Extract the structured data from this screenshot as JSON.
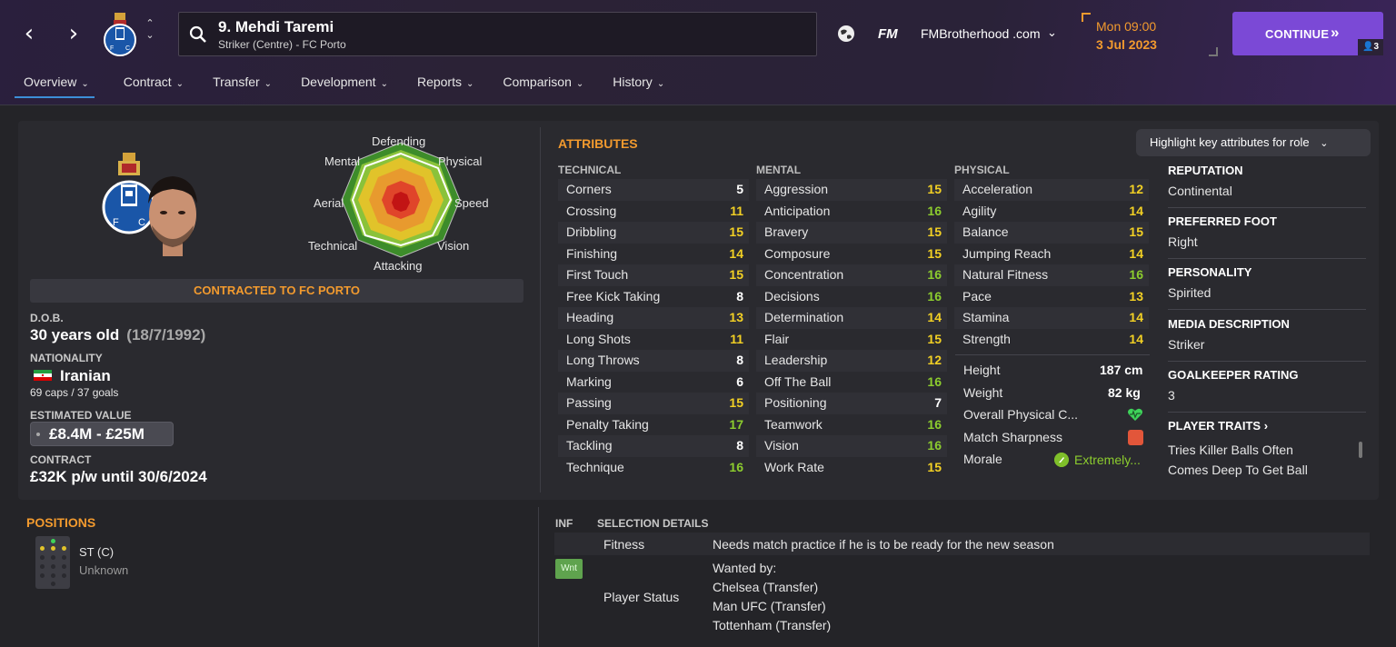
{
  "header": {
    "player_name": "9. Mehdi Taremi",
    "player_sub": "Striker (Centre) - FC Porto",
    "fm_logo": "FM",
    "brand": "FMBrotherhood .com",
    "time": "Mon 09:00",
    "date": "3 Jul 2023",
    "continue_label": "CONTINUE",
    "continue_badge": "3",
    "accent": "#7b49d6"
  },
  "tabs": [
    "Overview",
    "Contract",
    "Transfer",
    "Development",
    "Reports",
    "Comparison",
    "History"
  ],
  "profile": {
    "radar_labels": {
      "defending": "Defending",
      "physical": "Physical",
      "speed": "Speed",
      "vision": "Vision",
      "attacking": "Attacking",
      "technical": "Technical",
      "aerial": "Aerial",
      "mental": "Mental"
    },
    "contract_banner": "CONTRACTED TO FC PORTO",
    "dob_label": "D.O.B.",
    "dob_age": "30 years old",
    "dob_date": "(18/7/1992)",
    "nationality_label": "NATIONALITY",
    "nationality": "Iranian",
    "caps": "69 caps / 37 goals",
    "value_label": "ESTIMATED VALUE",
    "value": "£8.4M - £25M",
    "contract_label": "CONTRACT",
    "contract": "£32K p/w until 30/6/2024"
  },
  "attributes": {
    "title": "ATTRIBUTES",
    "highlight_btn": "Highlight key attributes for role",
    "technical_head": "TECHNICAL",
    "mental_head": "MENTAL",
    "physical_head": "PHYSICAL",
    "technical": [
      {
        "name": "Corners",
        "value": "5"
      },
      {
        "name": "Crossing",
        "value": "11"
      },
      {
        "name": "Dribbling",
        "value": "15"
      },
      {
        "name": "Finishing",
        "value": "14"
      },
      {
        "name": "First Touch",
        "value": "15"
      },
      {
        "name": "Free Kick Taking",
        "value": "8"
      },
      {
        "name": "Heading",
        "value": "13"
      },
      {
        "name": "Long Shots",
        "value": "11"
      },
      {
        "name": "Long Throws",
        "value": "8"
      },
      {
        "name": "Marking",
        "value": "6"
      },
      {
        "name": "Passing",
        "value": "15"
      },
      {
        "name": "Penalty Taking",
        "value": "17"
      },
      {
        "name": "Tackling",
        "value": "8"
      },
      {
        "name": "Technique",
        "value": "16"
      }
    ],
    "mental": [
      {
        "name": "Aggression",
        "value": "15"
      },
      {
        "name": "Anticipation",
        "value": "16"
      },
      {
        "name": "Bravery",
        "value": "15"
      },
      {
        "name": "Composure",
        "value": "15"
      },
      {
        "name": "Concentration",
        "value": "16"
      },
      {
        "name": "Decisions",
        "value": "16"
      },
      {
        "name": "Determination",
        "value": "14"
      },
      {
        "name": "Flair",
        "value": "15"
      },
      {
        "name": "Leadership",
        "value": "12"
      },
      {
        "name": "Off The Ball",
        "value": "16"
      },
      {
        "name": "Positioning",
        "value": "7"
      },
      {
        "name": "Teamwork",
        "value": "16"
      },
      {
        "name": "Vision",
        "value": "16"
      },
      {
        "name": "Work Rate",
        "value": "15"
      }
    ],
    "physical": [
      {
        "name": "Acceleration",
        "value": "12"
      },
      {
        "name": "Agility",
        "value": "14"
      },
      {
        "name": "Balance",
        "value": "15"
      },
      {
        "name": "Jumping Reach",
        "value": "14"
      },
      {
        "name": "Natural Fitness",
        "value": "16"
      },
      {
        "name": "Pace",
        "value": "13"
      },
      {
        "name": "Stamina",
        "value": "14"
      },
      {
        "name": "Strength",
        "value": "14"
      }
    ],
    "height_label": "Height",
    "height": "187 cm",
    "weight_label": "Weight",
    "weight": "82 kg",
    "overall_label": "Overall Physical C...",
    "sharpness_label": "Match Sharpness",
    "morale_label": "Morale",
    "morale": "Extremely..."
  },
  "info": {
    "reputation_label": "REPUTATION",
    "reputation": "Continental",
    "foot_label": "PREFERRED FOOT",
    "foot": "Right",
    "personality_label": "PERSONALITY",
    "personality": "Spirited",
    "media_label": "MEDIA DESCRIPTION",
    "media": "Striker",
    "gk_label": "GOALKEEPER RATING",
    "gk": "3",
    "traits_label": "PLAYER TRAITS",
    "traits": [
      "Tries Killer Balls Often",
      "Comes Deep To Get Ball"
    ]
  },
  "positions": {
    "title": "POSITIONS",
    "position": "ST (C)",
    "familiarity": "Unknown"
  },
  "selection": {
    "inf_head": "INF",
    "details_head": "SELECTION DETAILS",
    "fitness_label": "Fitness",
    "fitness": "Needs match practice if he is to be ready for the new season",
    "wnt": "Wnt",
    "status_label": "Player Status",
    "wanted_by": "Wanted by:",
    "clubs": [
      "Chelsea (Transfer)",
      "Man UFC (Transfer)",
      "Tottenham (Transfer)"
    ]
  },
  "colors": {
    "orange": "#f29a2e",
    "green": "#8ccc2e",
    "yellow": "#f2d024",
    "white": "#ffffff"
  }
}
